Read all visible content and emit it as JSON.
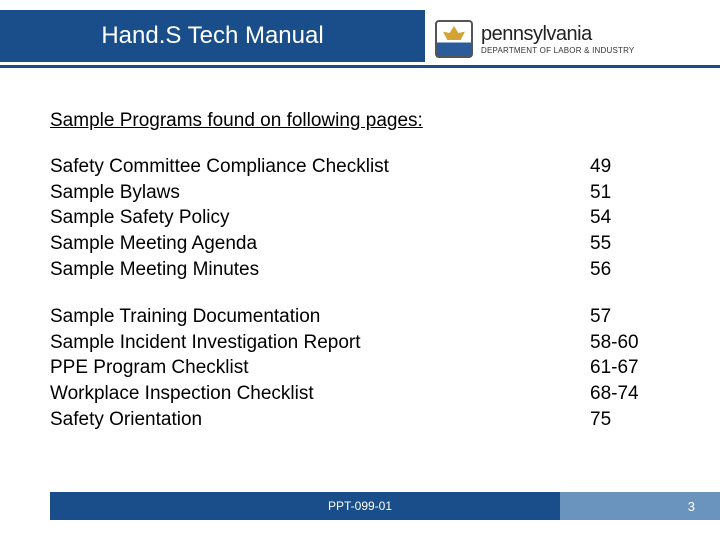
{
  "header": {
    "title": "Hand.S Tech Manual",
    "state": "pennsylvania",
    "department": "DEPARTMENT OF LABOR & INDUSTRY"
  },
  "intro": "Sample Programs found on following pages:",
  "group1": [
    {
      "label": "Safety Committee Compliance Checklist",
      "page": "49"
    },
    {
      "label": "Sample Bylaws",
      "page": "51"
    },
    {
      "label": "Sample Safety Policy",
      "page": "54"
    },
    {
      "label": "Sample Meeting Agenda",
      "page": "55"
    },
    {
      "label": "Sample Meeting Minutes",
      "page": "56"
    }
  ],
  "group2": [
    {
      "label": "Sample Training Documentation",
      "page": "57"
    },
    {
      "label": "Sample Incident Investigation Report",
      "page": "58-60"
    },
    {
      "label": "PPE Program Checklist",
      "page": "61-67"
    },
    {
      "label": "Workplace Inspection Checklist",
      "page": "68-74"
    },
    {
      "label": "Safety Orientation",
      "page": "75"
    }
  ],
  "footer": {
    "code": "PPT-099-01",
    "pageNumber": "3"
  }
}
